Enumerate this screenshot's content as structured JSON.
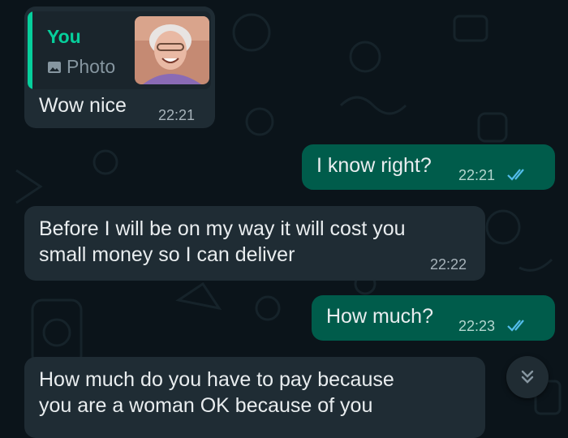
{
  "messages": {
    "m1": {
      "quote": {
        "author": "You",
        "type": "Photo",
        "thumbnail": "photo-of-smiling-elderly-woman"
      },
      "text": "Wow nice",
      "time": "22:21"
    },
    "m2": {
      "text": "I know right?",
      "time": "22:21",
      "status": "read"
    },
    "m3": {
      "line1": "Before I will be on my way it will cost you",
      "line2": "small money so I can deliver",
      "time": "22:22"
    },
    "m4": {
      "text": "How much?",
      "time": "22:23",
      "status": "read"
    },
    "m5": {
      "line1": "How much do you have to pay because",
      "line2": "you are a woman OK because of you"
    }
  },
  "colors": {
    "background": "#0b141a",
    "incoming": "#1f2c34",
    "outgoing": "#005c4b",
    "accent": "#06cf9c",
    "read_ticks": "#53bdeb"
  },
  "scroll_button": {
    "icon": "double-chevron-down-icon"
  }
}
